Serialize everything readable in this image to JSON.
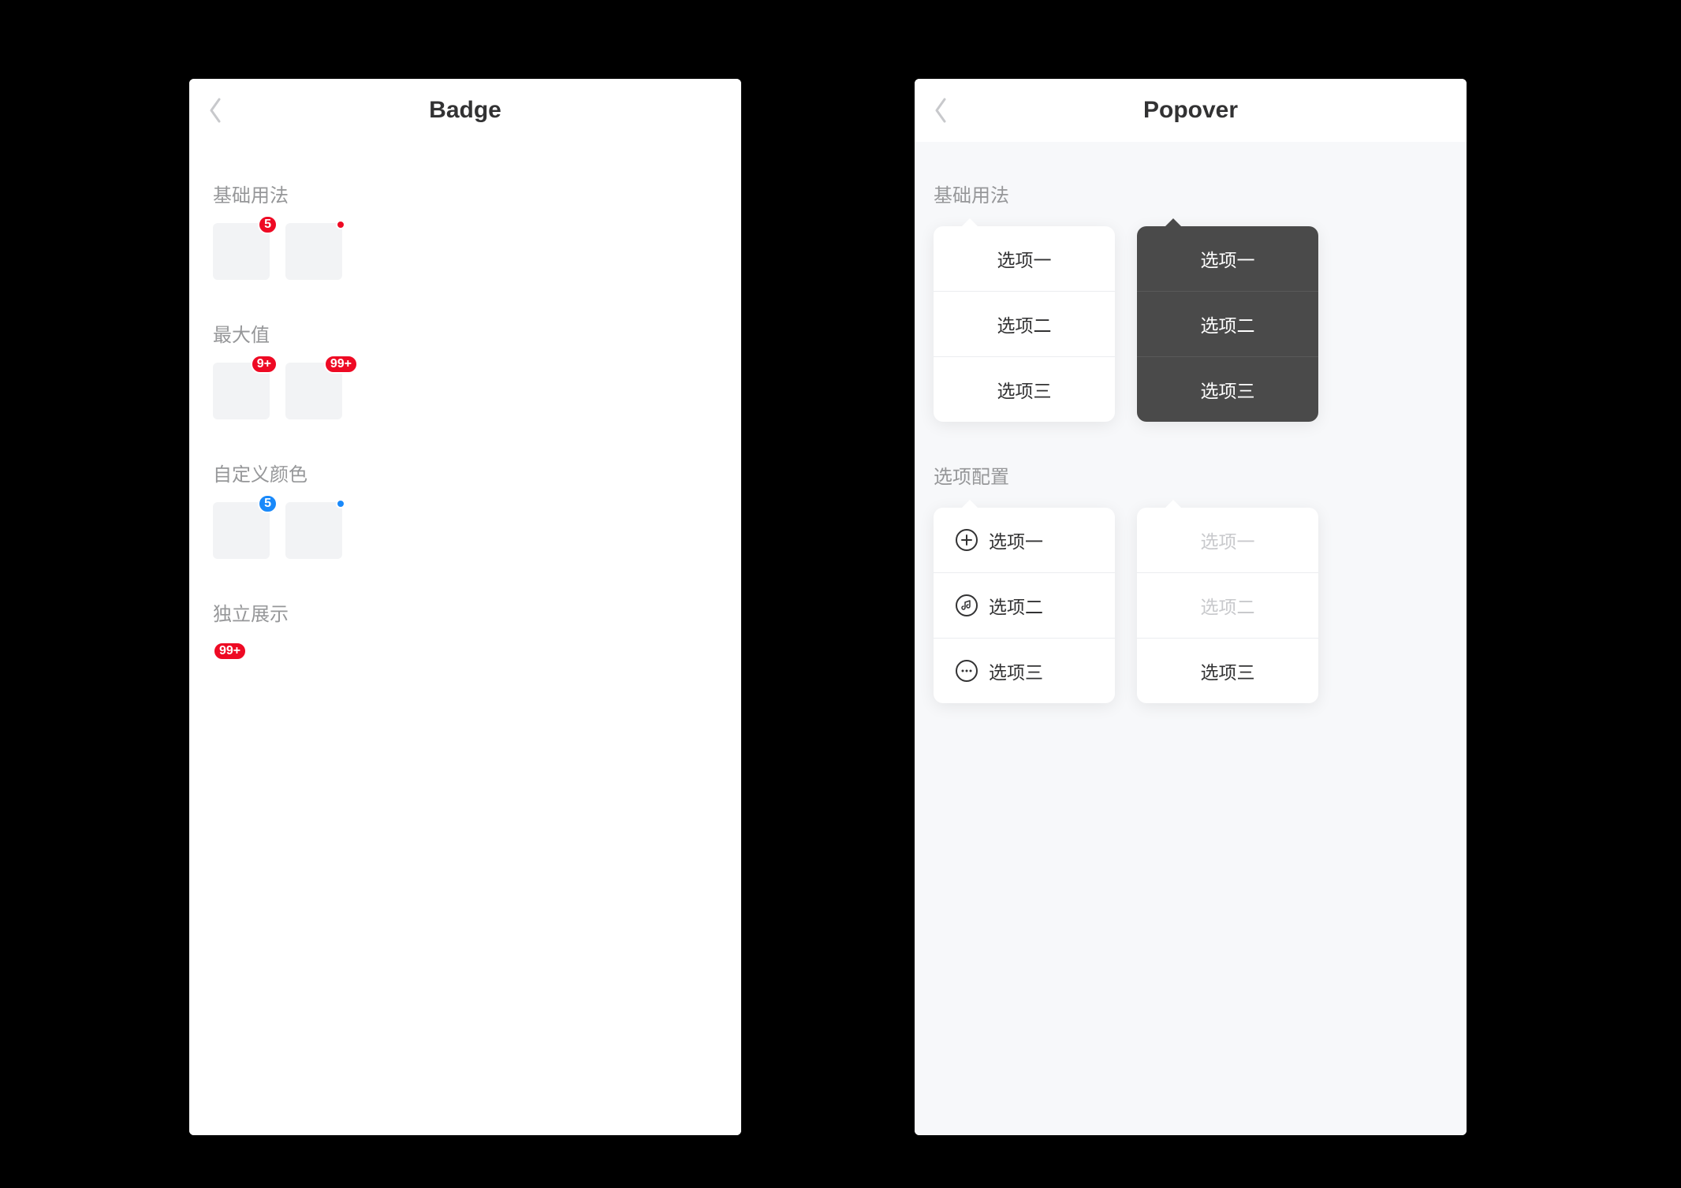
{
  "badge_screen": {
    "title": "Badge",
    "sections": {
      "basic": {
        "label": "基础用法",
        "values": [
          "5",
          "dot"
        ]
      },
      "max": {
        "label": "最大值",
        "values": [
          "9+",
          "99+"
        ]
      },
      "color": {
        "label": "自定义颜色",
        "values": [
          "5",
          "dot"
        ]
      },
      "alone": {
        "label": "独立展示",
        "values": [
          "99+"
        ]
      }
    },
    "colors": {
      "default": "#ee0a24",
      "custom": "#1989fa"
    }
  },
  "popover_screen": {
    "title": "Popover",
    "sections": {
      "basic": {
        "label": "基础用法"
      },
      "config": {
        "label": "选项配置"
      }
    },
    "options": {
      "light": [
        "选项一",
        "选项二",
        "选项三"
      ],
      "dark": [
        "选项一",
        "选项二",
        "选项三"
      ],
      "icons": [
        "选项一",
        "选项二",
        "选项三"
      ],
      "disabled": [
        "选项一",
        "选项二",
        "选项三"
      ]
    },
    "icon_names": [
      "plus-icon",
      "music-icon",
      "more-icon"
    ]
  }
}
